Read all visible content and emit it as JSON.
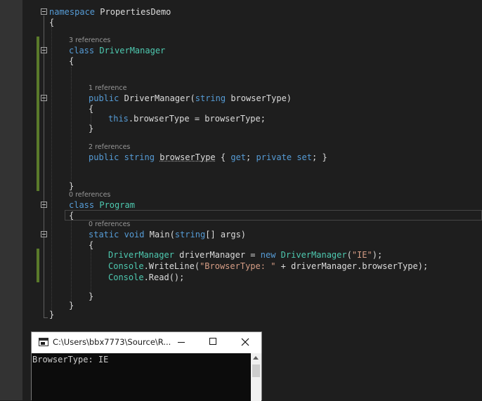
{
  "editor": {
    "lines": {
      "namespace_kw": "namespace",
      "namespace_name": "PropertiesDemo",
      "brace": "{",
      "brace_close": "}",
      "class_kw": "class",
      "class1_name": "DriverManager",
      "ctor_public": "public",
      "ctor_name": "DriverManager(",
      "ctor_param_type": "string",
      "ctor_param_name": " browserType)",
      "this_kw": "this",
      "this_rest": ".browserType = browserType;",
      "prop_public": "public",
      "prop_type": "string",
      "prop_name": "browserType",
      "prop_open": " { ",
      "prop_get": "get",
      "prop_semi": "; ",
      "prop_private": "private",
      "prop_set": "set",
      "prop_close": "; }",
      "class2_name": "Program",
      "main_static": "static",
      "main_void": "void",
      "main_name": " Main(",
      "main_param_type": "string",
      "main_param_rest": "[] args)",
      "s1_type": "DriverManager",
      "s1_mid": " driverManager = ",
      "s1_new": "new",
      "s1_type2": "DriverManager",
      "s1_paren": "(",
      "s1_str": "\"IE\"",
      "s1_end": ");",
      "s2_type": "Console",
      "s2_method": ".WriteLine(",
      "s2_str": "\"BrowserType: \"",
      "s2_rest": " + driverManager.browserType);",
      "s3_type": "Console",
      "s3_rest": ".Read();"
    },
    "lens": {
      "class_driver": "3 references",
      "ctor": "1 reference",
      "property": "2 references",
      "class_program": "0 references",
      "main": "0 references"
    }
  },
  "console": {
    "title": "C:\\Users\\bbx7773\\Source\\R...",
    "output": "BrowserType: IE"
  },
  "colors": {
    "keyword": "#569cd6",
    "type": "#4ec9b0",
    "string": "#d69d85",
    "text": "#dcdcdc",
    "lens": "#999999",
    "change_bar": "#5a7a2a"
  },
  "icons": [
    "collapse-icon",
    "console-app-icon",
    "minimize-icon",
    "maximize-icon",
    "close-icon",
    "scroll-up-arrow-icon"
  ]
}
